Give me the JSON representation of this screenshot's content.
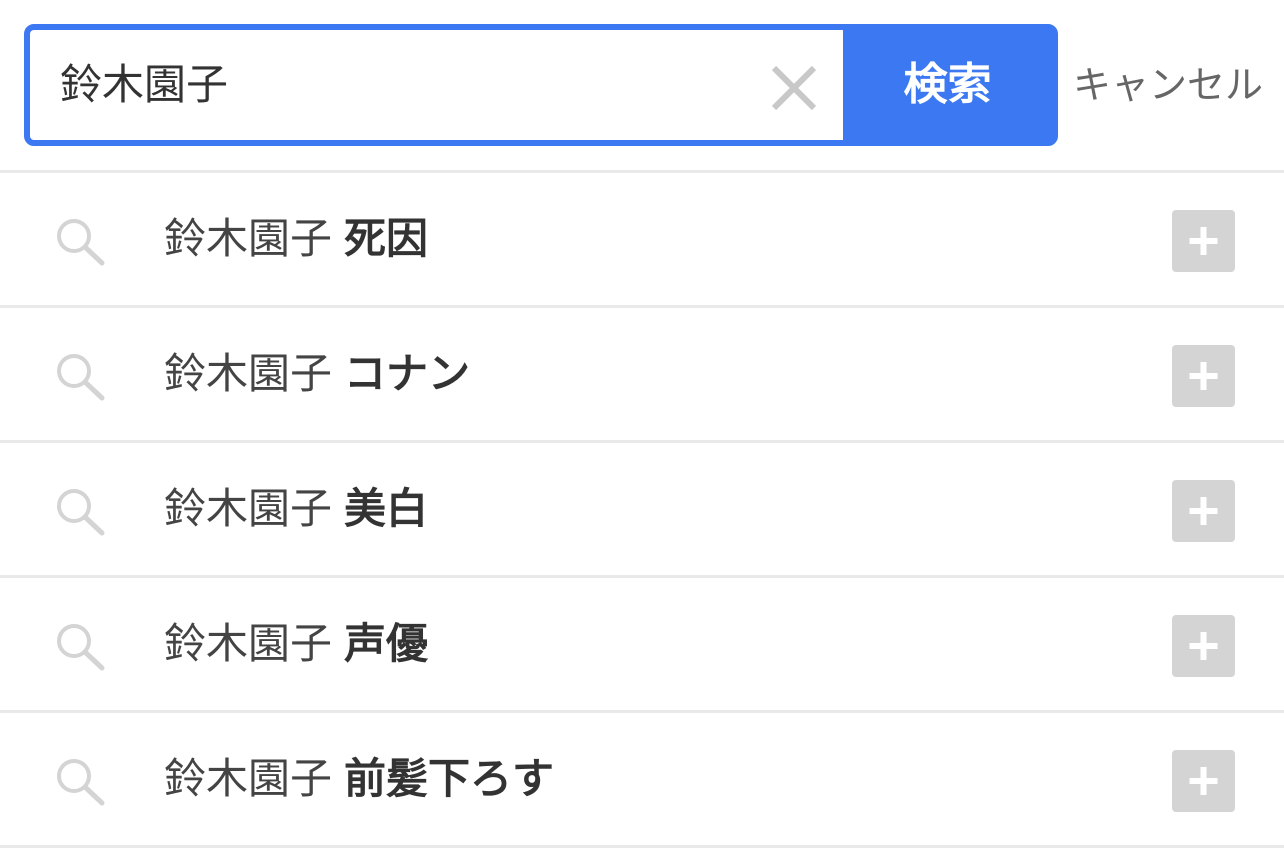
{
  "search": {
    "value": "鈴木園子",
    "button_label": "検索",
    "cancel_label": "キャンセル"
  },
  "suggestions": [
    {
      "query": "鈴木園子",
      "completion": "死因"
    },
    {
      "query": "鈴木園子",
      "completion": "コナン"
    },
    {
      "query": "鈴木園子",
      "completion": "美白"
    },
    {
      "query": "鈴木園子",
      "completion": "声優"
    },
    {
      "query": "鈴木園子",
      "completion": "前髪下ろす"
    }
  ],
  "icons": {
    "clear": "close-icon",
    "row": "search-icon",
    "add": "plus-icon"
  },
  "colors": {
    "accent": "#3b78f2",
    "icon_gray": "#d4d4d4",
    "divider": "#e9e9e9",
    "text": "#444444"
  }
}
